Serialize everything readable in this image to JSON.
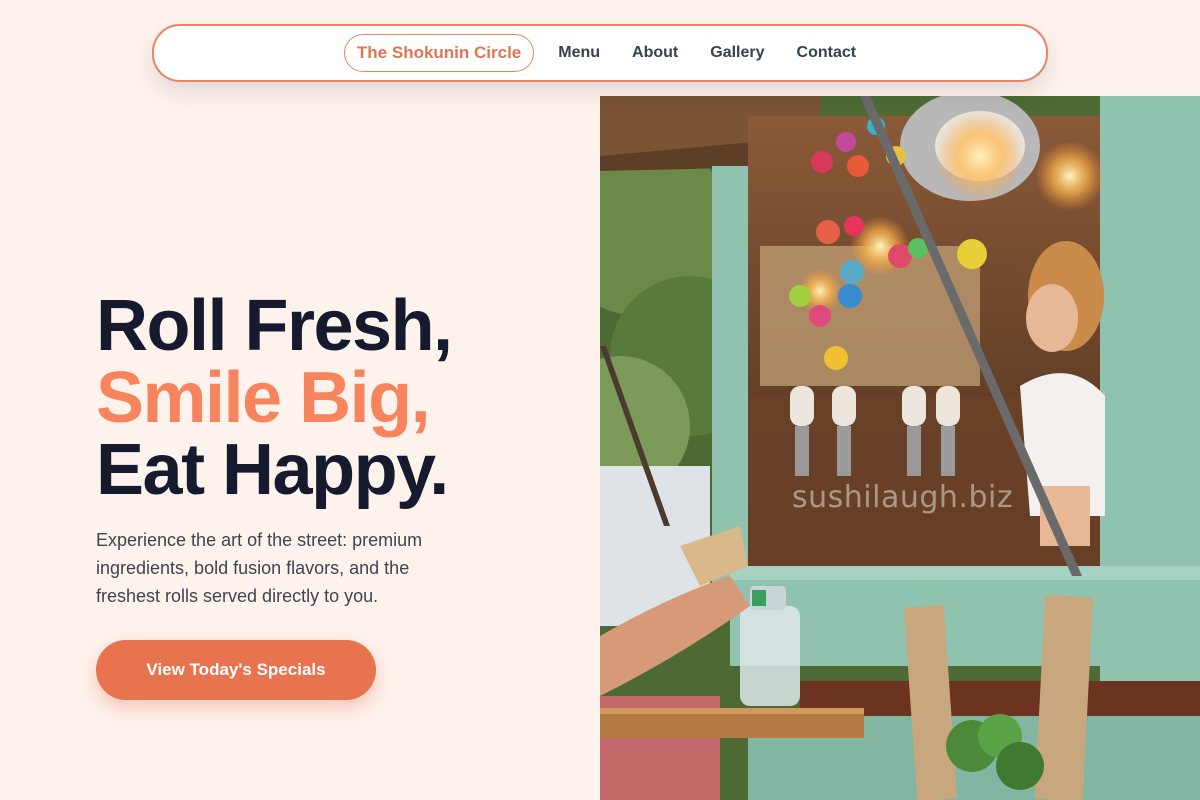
{
  "nav": {
    "brand": "The Shokunin Circle",
    "links": [
      "Menu",
      "About",
      "Gallery",
      "Contact"
    ]
  },
  "hero": {
    "headline": [
      "Roll Fresh,",
      "Smile Big,",
      "Eat Happy."
    ],
    "subtext": "Experience the art of the street: premium ingredients, bold fusion flavors, and the freshest rolls served directly to you.",
    "cta_label": "View Today's Specials",
    "image": {
      "subject": "food-truck-photo",
      "watermark": "sushilaugh.biz"
    }
  },
  "colors": {
    "background": "#fdf2ec",
    "accent": "#f7845c",
    "button": "#e8734f",
    "headline_dark": "#151a2e",
    "truck_green": "#8fc3b0"
  }
}
